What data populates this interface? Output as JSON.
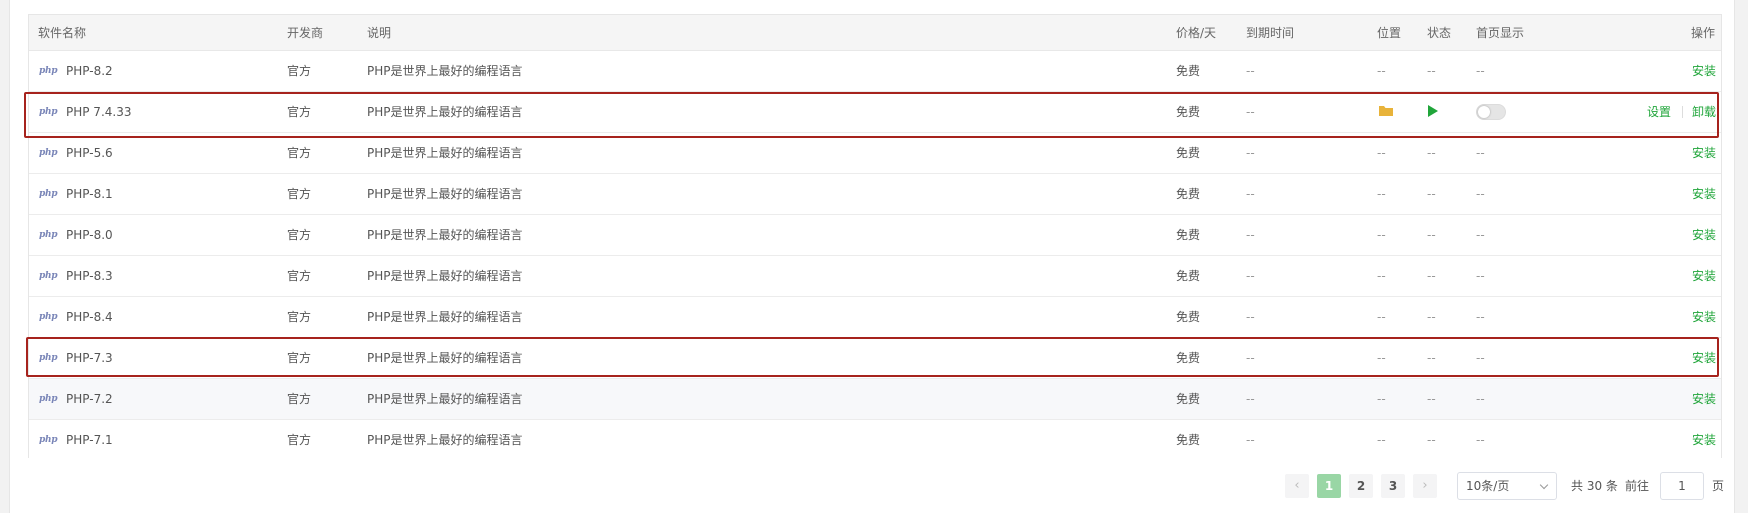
{
  "columns": {
    "name": "软件名称",
    "developer": "开发商",
    "description": "说明",
    "price": "价格/天",
    "expire": "到期时间",
    "location": "位置",
    "status": "状态",
    "homepage": "首页显示",
    "actions": "操作"
  },
  "icons": {
    "php": "php"
  },
  "rows": [
    {
      "name": "PHP-8.2",
      "developer": "官方",
      "description": "PHP是世界上最好的编程语言",
      "price": "免费",
      "expire": "--",
      "location": "--",
      "status": "--",
      "homepage": "--",
      "action": "安装"
    },
    {
      "name": "PHP 7.4.33",
      "developer": "官方",
      "description": "PHP是世界上最好的编程语言",
      "price": "免费",
      "expire": "--",
      "action_settings": "设置",
      "action_uninstall": "卸载"
    },
    {
      "name": "PHP-5.6",
      "developer": "官方",
      "description": "PHP是世界上最好的编程语言",
      "price": "免费",
      "expire": "--",
      "location": "--",
      "status": "--",
      "homepage": "--",
      "action": "安装"
    },
    {
      "name": "PHP-8.1",
      "developer": "官方",
      "description": "PHP是世界上最好的编程语言",
      "price": "免费",
      "expire": "--",
      "location": "--",
      "status": "--",
      "homepage": "--",
      "action": "安装"
    },
    {
      "name": "PHP-8.0",
      "developer": "官方",
      "description": "PHP是世界上最好的编程语言",
      "price": "免费",
      "expire": "--",
      "location": "--",
      "status": "--",
      "homepage": "--",
      "action": "安装"
    },
    {
      "name": "PHP-8.3",
      "developer": "官方",
      "description": "PHP是世界上最好的编程语言",
      "price": "免费",
      "expire": "--",
      "location": "--",
      "status": "--",
      "homepage": "--",
      "action": "安装"
    },
    {
      "name": "PHP-8.4",
      "developer": "官方",
      "description": "PHP是世界上最好的编程语言",
      "price": "免费",
      "expire": "--",
      "location": "--",
      "status": "--",
      "homepage": "--",
      "action": "安装"
    },
    {
      "name": "PHP-7.3",
      "developer": "官方",
      "description": "PHP是世界上最好的编程语言",
      "price": "免费",
      "expire": "--",
      "location": "--",
      "status": "--",
      "homepage": "--",
      "action": "安装"
    },
    {
      "name": "PHP-7.2",
      "developer": "官方",
      "description": "PHP是世界上最好的编程语言",
      "price": "免费",
      "expire": "--",
      "location": "--",
      "status": "--",
      "homepage": "--",
      "action": "安装"
    },
    {
      "name": "PHP-7.1",
      "developer": "官方",
      "description": "PHP是世界上最好的编程语言",
      "price": "免费",
      "expire": "--",
      "location": "--",
      "status": "--",
      "homepage": "--",
      "action": "安装"
    }
  ],
  "pagination": {
    "prev": "‹",
    "pages": [
      "1",
      "2",
      "3"
    ],
    "current_page": "1",
    "next": "›",
    "page_size": "10条/页",
    "total": "共 30 条",
    "goto_label": "前往",
    "goto_value": "1",
    "page_suffix": "页"
  },
  "colors": {
    "accent": "#20a53a",
    "highlight_border": "#a6231d",
    "folder": "#e8b33a"
  }
}
